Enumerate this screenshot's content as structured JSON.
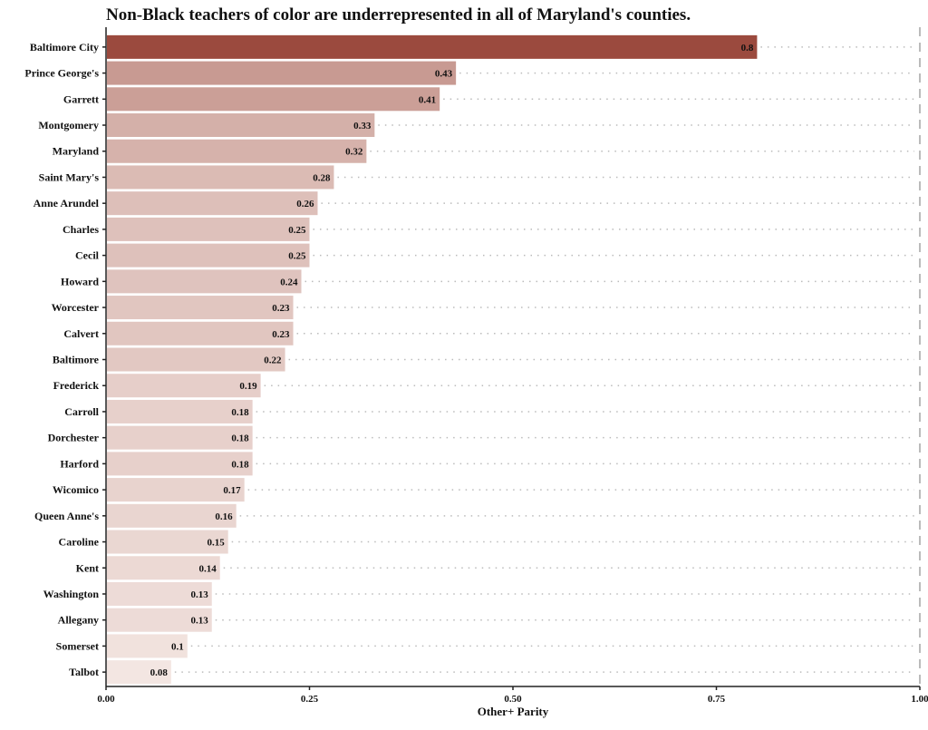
{
  "chart_data": {
    "type": "bar",
    "orientation": "horizontal",
    "title": "Non-Black teachers of color are underrepresented in all of Maryland's counties.",
    "xlabel": "Other+ Parity",
    "ylabel": "",
    "xlim": [
      0,
      1.0
    ],
    "xticks": [
      "0.00",
      "0.25",
      "0.50",
      "0.75",
      "1.00"
    ],
    "xtick_values": [
      0,
      0.25,
      0.5,
      0.75,
      1.0
    ],
    "reference_line": 1.0,
    "grid": "dotted horizontal guide lines per bar",
    "color_low": "#f3e6e2",
    "color_high": "#9b4a3e",
    "categories": [
      "Baltimore City",
      "Prince George's",
      "Garrett",
      "Montgomery",
      "Maryland",
      "Saint Mary's",
      "Anne Arundel",
      "Charles",
      "Cecil",
      "Howard",
      "Worcester",
      "Calvert",
      "Baltimore",
      "Frederick",
      "Carroll",
      "Dorchester",
      "Harford",
      "Wicomico",
      "Queen Anne's",
      "Caroline",
      "Kent",
      "Washington",
      "Allegany",
      "Somerset",
      "Talbot"
    ],
    "values": [
      0.8,
      0.43,
      0.41,
      0.33,
      0.32,
      0.28,
      0.26,
      0.25,
      0.25,
      0.24,
      0.23,
      0.23,
      0.22,
      0.19,
      0.18,
      0.18,
      0.18,
      0.17,
      0.16,
      0.15,
      0.14,
      0.13,
      0.13,
      0.1,
      0.08
    ],
    "labels": [
      "0.8",
      "0.43",
      "0.41",
      "0.33",
      "0.32",
      "0.28",
      "0.26",
      "0.25",
      "0.25",
      "0.24",
      "0.23",
      "0.23",
      "0.22",
      "0.19",
      "0.18",
      "0.18",
      "0.18",
      "0.17",
      "0.16",
      "0.15",
      "0.14",
      "0.13",
      "0.13",
      "0.1",
      "0.08"
    ]
  }
}
